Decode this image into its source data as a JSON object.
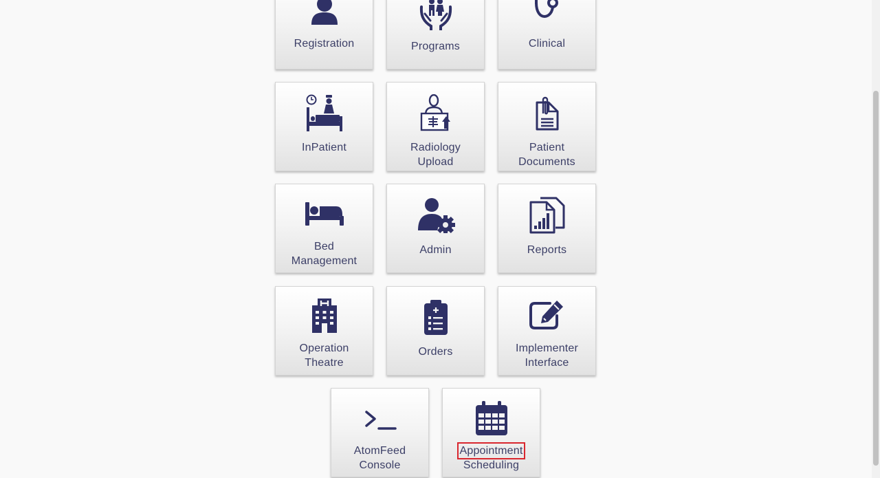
{
  "apps": {
    "registration": {
      "label": "Registration",
      "icon": "person-icon"
    },
    "programs": {
      "label": "Programs",
      "icon": "family-in-hands-icon"
    },
    "clinical": {
      "label": "Clinical",
      "icon": "stethoscope-icon"
    },
    "inpatient": {
      "label": "InPatient",
      "icon": "hospital-bed-nurse-icon"
    },
    "radiology": {
      "line1": "Radiology",
      "line2": "Upload",
      "icon": "xray-upload-icon"
    },
    "patient_documents": {
      "line1": "Patient",
      "line2": "Documents",
      "icon": "clipped-document-icon"
    },
    "bed_management": {
      "line1": "Bed",
      "line2": "Management",
      "icon": "bed-icon"
    },
    "admin": {
      "label": "Admin",
      "icon": "user-gear-icon"
    },
    "reports": {
      "label": "Reports",
      "icon": "report-chart-icon"
    },
    "operation_theatre": {
      "line1": "Operation",
      "line2": "Theatre",
      "icon": "hospital-building-icon"
    },
    "orders": {
      "label": "Orders",
      "icon": "clipboard-list-icon"
    },
    "implementer": {
      "line1": "Implementer",
      "line2": "Interface",
      "icon": "edit-icon"
    },
    "atomfeed": {
      "line1": "AtomFeed",
      "line2": "Console",
      "icon": "terminal-icon"
    },
    "appointment": {
      "line1": "Appointment",
      "line2": "Scheduling",
      "icon": "calendar-icon"
    }
  },
  "theme": {
    "icon_color": "#2f3166",
    "label_color": "#3b3e66",
    "highlight_color": "#d9262e"
  }
}
